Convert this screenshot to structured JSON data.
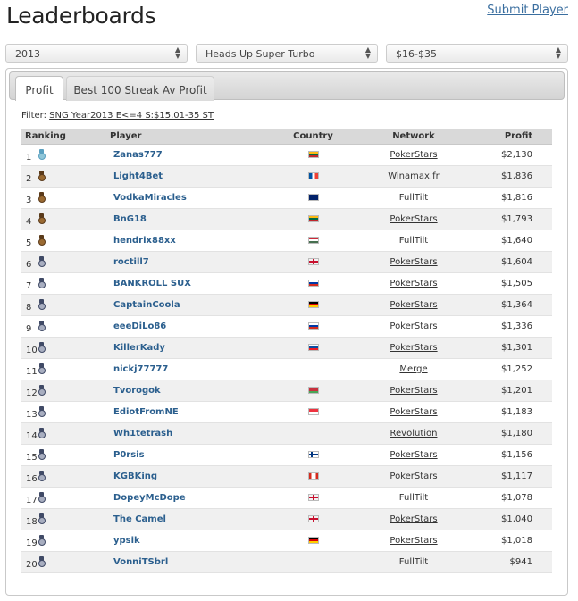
{
  "header": {
    "title": "Leaderboards",
    "submit_link": "Submit Player"
  },
  "filters": {
    "year": "2013",
    "game_type": "Heads Up Super Turbo",
    "stakes": "$16-$35"
  },
  "tabs": [
    {
      "label": "Profit",
      "active": true
    },
    {
      "label": "Best 100 Streak Av Profit",
      "active": false
    }
  ],
  "filter_text": {
    "label": "Filter:",
    "value": "SNG Year2013 E<=4 S:$15.01-35 ST"
  },
  "table": {
    "columns": [
      "Ranking",
      "Player",
      "Country",
      "Network",
      "Profit"
    ],
    "rows": [
      {
        "rank": "1",
        "player": "Zanas777",
        "flag": "lithuania",
        "network": "PokerStars",
        "network_link": true,
        "profit": "$2,130",
        "medal": "gold-icon"
      },
      {
        "rank": "2",
        "player": "Light4Bet",
        "flag": "france",
        "network": "Winamax.fr",
        "network_link": false,
        "profit": "$1,836",
        "medal": "bronze-icon"
      },
      {
        "rank": "3",
        "player": "VodkaMiracles",
        "flag": "australia",
        "network": "FullTilt",
        "network_link": false,
        "profit": "$1,816",
        "medal": "bronze-icon"
      },
      {
        "rank": "4",
        "player": "BnG18",
        "flag": "lithuania",
        "network": "PokerStars",
        "network_link": true,
        "profit": "$1,793",
        "medal": "bronze-icon"
      },
      {
        "rank": "5",
        "player": "hendrix88xx",
        "flag": "hungary",
        "network": "FullTilt",
        "network_link": false,
        "profit": "$1,640",
        "medal": "bronze-icon"
      },
      {
        "rank": "6",
        "player": "roctill7",
        "flag": "uk",
        "network": "PokerStars",
        "network_link": true,
        "profit": "$1,604",
        "medal": "silver-icon"
      },
      {
        "rank": "7",
        "player": "BANKROLL SUX",
        "flag": "russia",
        "network": "PokerStars",
        "network_link": true,
        "profit": "$1,505",
        "medal": "silver-icon"
      },
      {
        "rank": "8",
        "player": "CaptainCoola",
        "flag": "germany",
        "network": "PokerStars",
        "network_link": true,
        "profit": "$1,364",
        "medal": "silver-icon"
      },
      {
        "rank": "9",
        "player": "eeeDiLo86",
        "flag": "russia",
        "network": "PokerStars",
        "network_link": true,
        "profit": "$1,336",
        "medal": "silver-icon"
      },
      {
        "rank": "10",
        "player": "KillerKady",
        "flag": "slovakia",
        "network": "PokerStars",
        "network_link": true,
        "profit": "$1,301",
        "medal": "silver-icon"
      },
      {
        "rank": "11",
        "player": "nickj77777",
        "flag": "",
        "network": "Merge",
        "network_link": true,
        "profit": "$1,252",
        "medal": "silver-icon"
      },
      {
        "rank": "12",
        "player": "Tvorogok",
        "flag": "belarus",
        "network": "PokerStars",
        "network_link": true,
        "profit": "$1,201",
        "medal": "silver-icon"
      },
      {
        "rank": "13",
        "player": "EdiotFromNE",
        "flag": "singapore",
        "network": "PokerStars",
        "network_link": true,
        "profit": "$1,183",
        "medal": "silver-icon"
      },
      {
        "rank": "14",
        "player": "Wh1tetrash",
        "flag": "",
        "network": "Revolution",
        "network_link": true,
        "profit": "$1,180",
        "medal": "silver-icon"
      },
      {
        "rank": "15",
        "player": "P0rsis",
        "flag": "finland",
        "network": "PokerStars",
        "network_link": true,
        "profit": "$1,156",
        "medal": "silver-icon"
      },
      {
        "rank": "16",
        "player": "KGBKing",
        "flag": "canada",
        "network": "PokerStars",
        "network_link": true,
        "profit": "$1,117",
        "medal": "silver-icon"
      },
      {
        "rank": "17",
        "player": "DopeyMcDope",
        "flag": "uk",
        "network": "FullTilt",
        "network_link": false,
        "profit": "$1,078",
        "medal": "silver-icon"
      },
      {
        "rank": "18",
        "player": "The Camel",
        "flag": "uk",
        "network": "PokerStars",
        "network_link": true,
        "profit": "$1,040",
        "medal": "silver-icon"
      },
      {
        "rank": "19",
        "player": "ypsik",
        "flag": "germany",
        "network": "PokerStars",
        "network_link": true,
        "profit": "$1,018",
        "medal": "silver-icon"
      },
      {
        "rank": "20",
        "player": "VonniTSbrl",
        "flag": "",
        "network": "FullTilt",
        "network_link": false,
        "profit": "$941",
        "medal": "silver-icon"
      }
    ]
  },
  "colors": {
    "link": "#2b5f8e",
    "header_bg": "#d9d9d9",
    "stripe": "#f0f0f0"
  }
}
